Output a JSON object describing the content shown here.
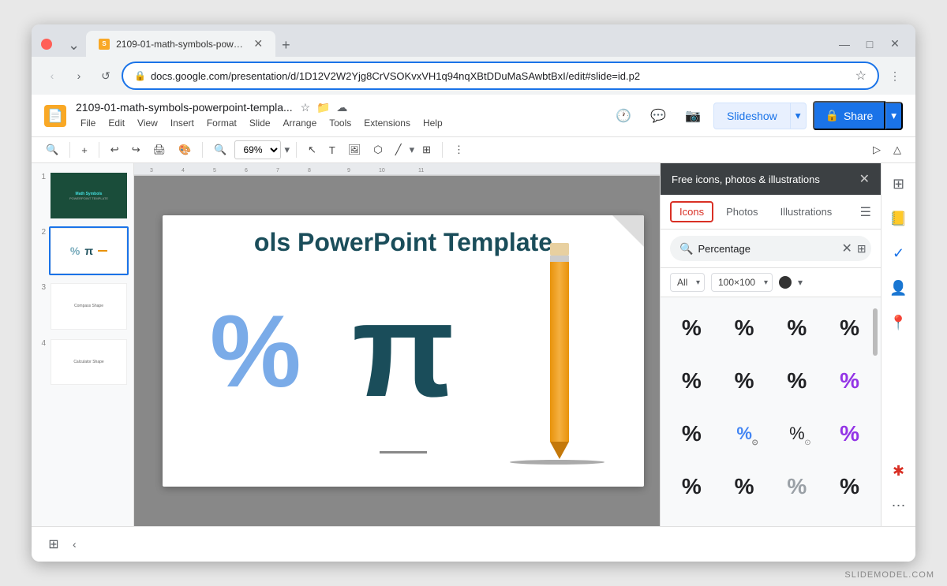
{
  "browser": {
    "tab_title": "2109-01-math-symbols-power...",
    "tab_favicon": "S",
    "url": "docs.google.com/presentation/d/1D12V2W2Yjg8CrVSOKvxVH1q94nqXBtDDuMaSAwbtBxI/edit#slide=id.p2",
    "new_tab_label": "+",
    "window_controls": {
      "minimize": "—",
      "maximize": "□",
      "close": "✕"
    },
    "back_btn": "‹",
    "forward_btn": "›",
    "refresh_btn": "↺"
  },
  "app": {
    "title": "2109-01-math-symbols-powerpoint-templa...",
    "favicon_char": "S",
    "menu_items": [
      "File",
      "Edit",
      "View",
      "Insert",
      "Format",
      "Slide",
      "Arrange",
      "Tools",
      "Extensions",
      "Help"
    ]
  },
  "toolbar": {
    "zoom": "69%",
    "slideshow_label": "Slideshow",
    "share_label": "Share"
  },
  "slides": [
    {
      "num": "1",
      "type": "dark"
    },
    {
      "num": "2",
      "type": "symbols"
    },
    {
      "num": "3",
      "type": "compass"
    },
    {
      "num": "4",
      "type": "calculator"
    }
  ],
  "main_slide": {
    "title": "ols PowerPoint Template",
    "percent_char": "%",
    "pi_char": "π"
  },
  "panel": {
    "header_title": "Free icons, photos & illustrations",
    "close_btn": "✕",
    "tabs": [
      "Icons",
      "Photos",
      "Illustrations"
    ],
    "active_tab": "Icons",
    "search_value": "Percentage",
    "filter_all": "All",
    "filter_size": "100×100",
    "scroll_right": "›",
    "icons": [
      {
        "char": "%",
        "style": "black"
      },
      {
        "char": "%",
        "style": "black"
      },
      {
        "char": "%",
        "style": "black"
      },
      {
        "char": "%",
        "style": "black"
      },
      {
        "char": "%",
        "style": "black"
      },
      {
        "char": "%",
        "style": "black"
      },
      {
        "char": "%",
        "style": "black"
      },
      {
        "char": "%",
        "style": "purple"
      },
      {
        "char": "%",
        "style": "black"
      },
      {
        "char": "%",
        "style": "blue-circle"
      },
      {
        "char": "%",
        "style": "circle-outlined"
      },
      {
        "char": "%",
        "style": "purple"
      },
      {
        "char": "%",
        "style": "black"
      },
      {
        "char": "%",
        "style": "black"
      },
      {
        "char": "%",
        "style": "gray-slash"
      },
      {
        "char": "%",
        "style": "black"
      }
    ]
  },
  "side_icons": {
    "grid_icon": "⊞",
    "sheets_icon": "⊟",
    "tasks_icon": "✓",
    "contacts_icon": "👤",
    "maps_icon": "📍",
    "asterisk_icon": "*",
    "more_icon": "⋯"
  },
  "watermark": "SLIDEMODEL.COM"
}
